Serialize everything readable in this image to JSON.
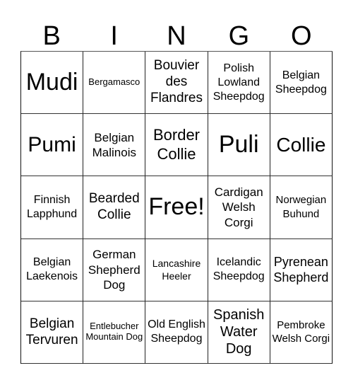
{
  "header": {
    "letters": [
      "B",
      "I",
      "N",
      "G",
      "O"
    ]
  },
  "board": {
    "cells": [
      "Mudi",
      "Bergamasco",
      "Bouvier des Flandres",
      "Polish Lowland Sheepdog",
      "Belgian Sheepdog",
      "Pumi",
      "Belgian Malinois",
      "Border Collie",
      "Puli",
      "Collie",
      "Finnish Lapphund",
      "Bearded Collie",
      "Free!",
      "Cardigan Welsh Corgi",
      "Norwegian Buhund",
      "Belgian Laekenois",
      "German Shepherd Dog",
      "Lancashire Heeler",
      "Icelandic Sheepdog",
      "Pyrenean Shepherd",
      "Belgian Tervuren",
      "Entlebucher Mountain Dog",
      "Old English Sheepdog",
      "Spanish Water Dog",
      "Pembroke Welsh Corgi"
    ],
    "free_space_index": 12
  }
}
